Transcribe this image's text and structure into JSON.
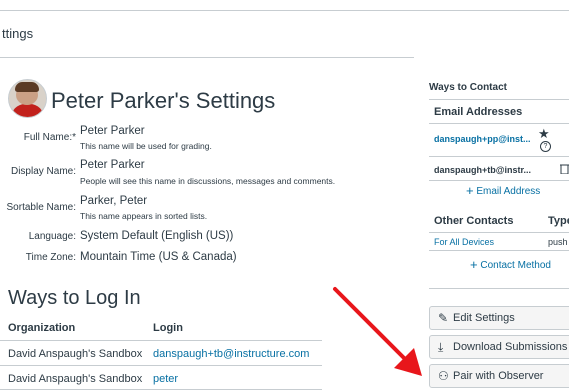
{
  "breadcrumb": "ttings",
  "profile": {
    "title": "Peter Parker's Settings",
    "fields": [
      {
        "label": "Full Name:*",
        "value": "Peter Parker",
        "hint": "This name will be used for grading."
      },
      {
        "label": "Display Name:",
        "value": "Peter Parker",
        "hint": "People will see this name in discussions, messages and comments."
      },
      {
        "label": "Sortable Name:",
        "value": "Parker, Peter",
        "hint": "This name appears in sorted lists."
      },
      {
        "label": "Language:",
        "value": "System Default (English (US))"
      },
      {
        "label": "Time Zone:",
        "value": "Mountain Time (US & Canada)"
      }
    ]
  },
  "ways_to_log_in": {
    "title": "Ways to Log In",
    "headers": [
      "Organization",
      "Login"
    ],
    "rows": [
      {
        "org": "David Anspaugh's Sandbox",
        "login": "danspaugh+tb@instructure.com"
      },
      {
        "org": "David Anspaugh's Sandbox",
        "login": "peter"
      }
    ]
  },
  "ways_to_contact": {
    "title": "Ways to Contact",
    "email_header": "Email Addresses",
    "emails": [
      "danspaugh+pp@inst...",
      "danspaugh+tb@instr..."
    ],
    "add_email": "Email Address",
    "other_header": "Other Contacts",
    "type_header": "Type",
    "other_rows": [
      {
        "name": "For All Devices",
        "type": "push"
      }
    ],
    "add_contact": "Contact Method"
  },
  "buttons": {
    "edit": "Edit Settings",
    "download": "Download Submissions",
    "pair": "Pair with Observer"
  },
  "icons": {
    "star": "star-icon",
    "info": "info-icon",
    "trash": "trash-icon",
    "pencil": "pencil-icon",
    "download": "download-icon",
    "people": "people-icon"
  },
  "colors": {
    "link": "#0770a3",
    "arrow": "#e8161b",
    "text": "#2d3b45"
  }
}
